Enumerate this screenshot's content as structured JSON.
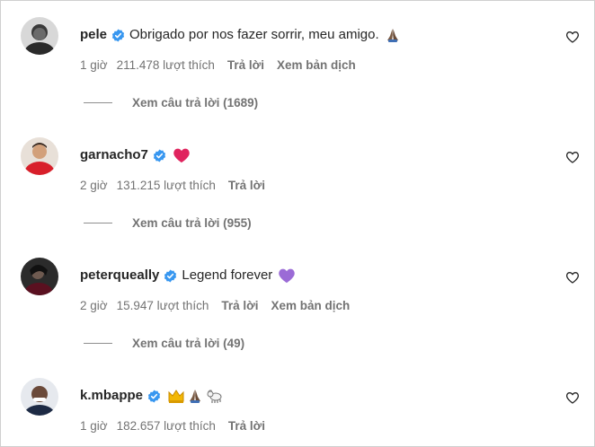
{
  "comments": [
    {
      "username": "pele",
      "text": "Obrigado por nos fazer sorrir, meu amigo.",
      "emoji": [
        "folded-hands"
      ],
      "time": "1 giờ",
      "likes": "211.478 lượt thích",
      "reply": "Trả lời",
      "translate": "Xem bản dịch",
      "view_replies": "Xem câu trả lời (1689)"
    },
    {
      "username": "garnacho7",
      "text": "",
      "emoji": [
        "red-heart"
      ],
      "time": "2 giờ",
      "likes": "131.215 lượt thích",
      "reply": "Trả lời",
      "view_replies": "Xem câu trả lời (955)"
    },
    {
      "username": "peterqueally",
      "text": "Legend forever",
      "emoji": [
        "purple-heart"
      ],
      "time": "2 giờ",
      "likes": "15.947 lượt thích",
      "reply": "Trả lời",
      "translate": "Xem bản dịch",
      "view_replies": "Xem câu trả lời (49)"
    },
    {
      "username": "k.mbappe",
      "text": "",
      "emoji": [
        "crown",
        "folded-hands",
        "goat"
      ],
      "time": "1 giờ",
      "likes": "182.657 lượt thích",
      "reply": "Trả lời"
    }
  ],
  "colors": {
    "verified": "#3897f0",
    "meta_text": "#737373",
    "red_heart": "#e0245e",
    "purple_heart": "#9b6bd6"
  }
}
